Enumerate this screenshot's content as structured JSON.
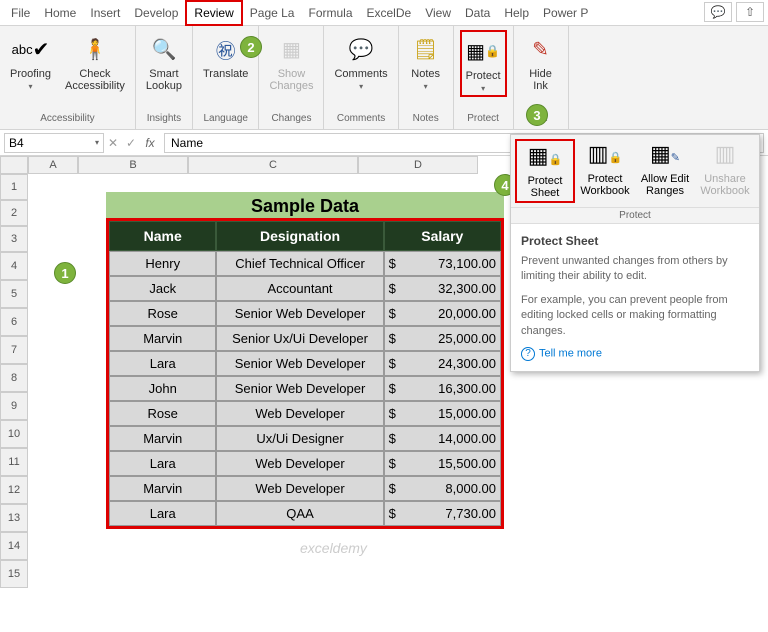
{
  "tabs": [
    "File",
    "Home",
    "Insert",
    "Develop",
    "Review",
    "Page La",
    "Formula",
    "ExcelDe",
    "View",
    "Data",
    "Help",
    "Power P"
  ],
  "active_tab": "Review",
  "ribbon_groups": {
    "accessibility": {
      "label": "Accessibility",
      "proofing": "Proofing",
      "proofing_abc": "abc",
      "check": "Check\nAccessibility"
    },
    "insights": {
      "label": "Insights",
      "smart": "Smart\nLookup"
    },
    "language": {
      "label": "Language",
      "translate": "Translate"
    },
    "changes": {
      "label": "Changes",
      "show": "Show\nChanges"
    },
    "comments": {
      "label": "Comments",
      "comments": "Comments"
    },
    "notes": {
      "label": "Notes",
      "notes": "Notes"
    },
    "protect": {
      "label": "Protect",
      "protect": "Protect"
    },
    "ink": {
      "label": "Ink",
      "hide": "Hide\nInk"
    }
  },
  "namebox": "B4",
  "formula": "Name",
  "cols": [
    "A",
    "B",
    "C",
    "D"
  ],
  "rows": [
    "1",
    "2",
    "3",
    "4",
    "5",
    "6",
    "7",
    "8",
    "9",
    "10",
    "11",
    "12",
    "13",
    "14",
    "15"
  ],
  "table_title": "Sample Data",
  "headers": {
    "name": "Name",
    "designation": "Designation",
    "salary": "Salary"
  },
  "data": [
    {
      "name": "Henry",
      "des": "Chief Technical Officer",
      "sal": "73,100.00"
    },
    {
      "name": "Jack",
      "des": "Accountant",
      "sal": "32,300.00"
    },
    {
      "name": "Rose",
      "des": "Senior Web Developer",
      "sal": "20,000.00"
    },
    {
      "name": "Marvin",
      "des": "Senior Ux/Ui Developer",
      "sal": "25,000.00"
    },
    {
      "name": "Lara",
      "des": "Senior Web Developer",
      "sal": "24,300.00"
    },
    {
      "name": "John",
      "des": "Senior Web Developer",
      "sal": "16,300.00"
    },
    {
      "name": "Rose",
      "des": "Web Developer",
      "sal": "15,000.00"
    },
    {
      "name": "Marvin",
      "des": "Ux/Ui Designer",
      "sal": "14,000.00"
    },
    {
      "name": "Lara",
      "des": "Web Developer",
      "sal": "15,500.00"
    },
    {
      "name": "Marvin",
      "des": "Web Developer",
      "sal": "8,000.00"
    },
    {
      "name": "Lara",
      "des": "QAA",
      "sal": "7,730.00"
    }
  ],
  "dropdown": {
    "protect_sheet": "Protect\nSheet",
    "protect_wb": "Protect\nWorkbook",
    "allow_edit": "Allow Edit\nRanges",
    "unshare": "Unshare\nWorkbook",
    "group": "Protect",
    "tip_title": "Protect Sheet",
    "tip_p1": "Prevent unwanted changes from others by limiting their ability to edit.",
    "tip_p2": "For example, you can prevent people from editing locked cells or making formatting changes.",
    "tellme": "Tell me more"
  },
  "watermark": "exceldemy"
}
